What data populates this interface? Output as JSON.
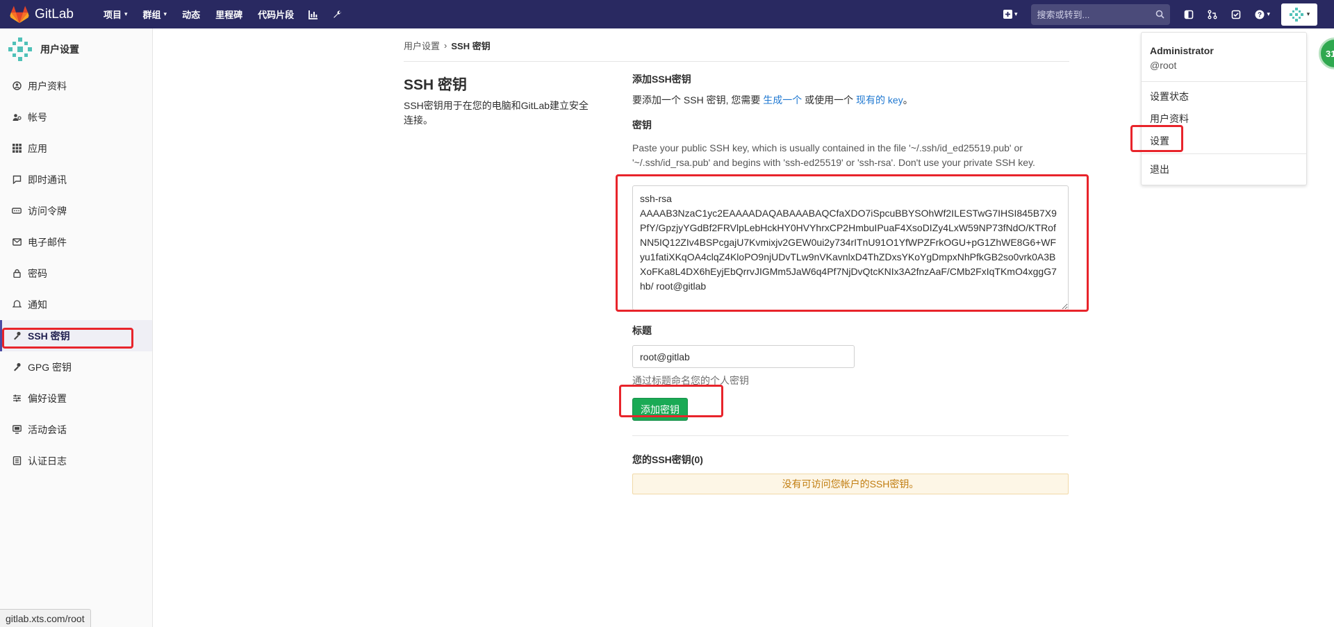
{
  "nav": {
    "brand": "GitLab",
    "links": [
      {
        "label": "项目",
        "caret": true
      },
      {
        "label": "群组",
        "caret": true
      },
      {
        "label": "动态",
        "caret": false
      },
      {
        "label": "里程碑",
        "caret": false
      },
      {
        "label": "代码片段",
        "caret": false
      }
    ],
    "search_placeholder": "搜索或转到...",
    "icons": [
      "chart-icon",
      "wrench-icon",
      "plus-icon",
      "search-icon",
      "sidebar-toggle-icon",
      "merge-request-icon",
      "todo-icon",
      "help-icon"
    ],
    "brand_color": "#292961"
  },
  "sidebar": {
    "title": "用户设置",
    "items": [
      {
        "label": "用户资料",
        "icon": "profile-icon"
      },
      {
        "label": "帐号",
        "icon": "account-icon"
      },
      {
        "label": "应用",
        "icon": "applications-icon"
      },
      {
        "label": "即时通讯",
        "icon": "chat-icon"
      },
      {
        "label": "访问令牌",
        "icon": "token-icon"
      },
      {
        "label": "电子邮件",
        "icon": "email-icon"
      },
      {
        "label": "密码",
        "icon": "lock-icon"
      },
      {
        "label": "通知",
        "icon": "bell-icon"
      },
      {
        "label": "SSH 密钥",
        "icon": "key-icon",
        "active": true
      },
      {
        "label": "GPG 密钥",
        "icon": "key-icon"
      },
      {
        "label": "偏好设置",
        "icon": "preferences-icon"
      },
      {
        "label": "活动会话",
        "icon": "monitor-icon"
      },
      {
        "label": "认证日志",
        "icon": "log-icon"
      }
    ]
  },
  "status_url": "gitlab.xts.com/root",
  "breadcrumb": {
    "parent": "用户设置",
    "current": "SSH 密钥"
  },
  "page": {
    "title": "SSH 密钥",
    "description": "SSH密钥用于在您的电脑和GitLab建立安全连接。"
  },
  "form": {
    "add_heading": "添加SSH密钥",
    "add_desc_prefix": "要添加一个 SSH 密钥, 您需要 ",
    "add_desc_link1": "生成一个",
    "add_desc_middle": " 或使用一个 ",
    "add_desc_link2": "现有的 key",
    "add_desc_suffix": "。",
    "key_label": "密钥",
    "key_help": "Paste your public SSH key, which is usually contained in the file '~/.ssh/id_ed25519.pub' or '~/.ssh/id_rsa.pub' and begins with 'ssh-ed25519' or 'ssh-rsa'. Don't use your private SSH key.",
    "key_value": "ssh-rsa\nAAAAB3NzaC1yc2EAAAADAQABAAABAQCfaXDO7iSpcuBBYSOhWf2ILESTwG7IHSI845B7X9PfY/GpzjyYGdBf2FRVlpLebHckHY0HVYhrxCP2HmbuIPuaF4XsoDIZy4LxW59NP73fNdO/KTRofNN5IQ12ZIv4BSPcgajU7Kvmixjv2GEW0ui2y734rITnU91O1YfWPZFrkOGU+pG1ZhWE8G6+WFyu1fatiXKqOA4clqZ4KloPO9njUDvTLw9nVKavnlxD4ThZDxsYKoYgDmpxNhPfkGB2so0vrk0A3BXoFKa8L4DX6hEyjEbQrrvJIGMm5JaW6q4Pf7NjDvQtcKNIx3A2fnzAaF/CMb2FxIqTKmO4xggG7hb/ root@gitlab",
    "title_label": "标题",
    "title_value": "root@gitlab",
    "title_hint": "通过标题命名您的个人密钥",
    "submit_label": "添加密钥",
    "your_keys_label": "您的SSH密钥(0)",
    "empty_message": "没有可访问您帐户的SSH密钥。",
    "submit_color": "#1aaa55"
  },
  "dropdown": {
    "name": "Administrator",
    "username": "@root",
    "items": [
      "设置状态",
      "用户资料",
      "设置",
      "退出"
    ]
  },
  "badge": {
    "text": "31"
  },
  "highlight_color": "#e8242b"
}
